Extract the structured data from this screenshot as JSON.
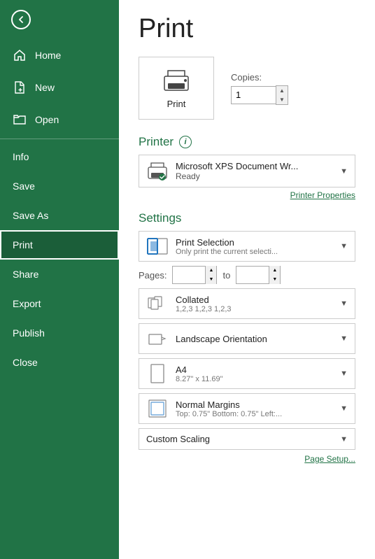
{
  "sidebar": {
    "items": [
      {
        "id": "back",
        "label": "",
        "icon": "back-icon"
      },
      {
        "id": "home",
        "label": "Home",
        "icon": "home-icon"
      },
      {
        "id": "new",
        "label": "New",
        "icon": "new-icon"
      },
      {
        "id": "open",
        "label": "Open",
        "icon": "open-icon"
      },
      {
        "id": "info",
        "label": "Info",
        "icon": "info-nav-icon"
      },
      {
        "id": "save",
        "label": "Save",
        "icon": "save-icon"
      },
      {
        "id": "save-as",
        "label": "Save As",
        "icon": "save-as-icon"
      },
      {
        "id": "print",
        "label": "Print",
        "icon": "print-nav-icon",
        "active": true
      },
      {
        "id": "share",
        "label": "Share",
        "icon": "share-icon"
      },
      {
        "id": "export",
        "label": "Export",
        "icon": "export-icon"
      },
      {
        "id": "publish",
        "label": "Publish",
        "icon": "publish-icon"
      },
      {
        "id": "close",
        "label": "Close",
        "icon": "close-nav-icon"
      }
    ]
  },
  "main": {
    "title": "Print",
    "print_button_label": "Print",
    "copies_label": "Copies:",
    "copies_value": "1",
    "printer_section": "Printer",
    "printer_name": "Microsoft XPS Document Wr...",
    "printer_status": "Ready",
    "printer_properties_label": "Printer Properties",
    "info_icon": "i",
    "settings_section": "Settings",
    "pages_label": "Pages:",
    "pages_to": "to",
    "page_setup_label": "Page Setup...",
    "settings": [
      {
        "id": "print-selection",
        "main": "Print Selection",
        "sub": "Only print the current selecti...",
        "icon": "print-selection-icon"
      },
      {
        "id": "collated",
        "main": "Collated",
        "sub": "1,2,3    1,2,3    1,2,3",
        "icon": "collated-icon"
      },
      {
        "id": "orientation",
        "main": "Landscape Orientation",
        "sub": "",
        "icon": "landscape-icon"
      },
      {
        "id": "paper-size",
        "main": "A4",
        "sub": "8.27\" x 11.69\"",
        "icon": "paper-icon"
      },
      {
        "id": "margins",
        "main": "Normal Margins",
        "sub": "Top: 0.75\" Bottom: 0.75\" Left:...",
        "icon": "margins-icon"
      },
      {
        "id": "scaling",
        "main": "Custom Scaling",
        "sub": "",
        "icon": "scaling-icon"
      }
    ]
  }
}
